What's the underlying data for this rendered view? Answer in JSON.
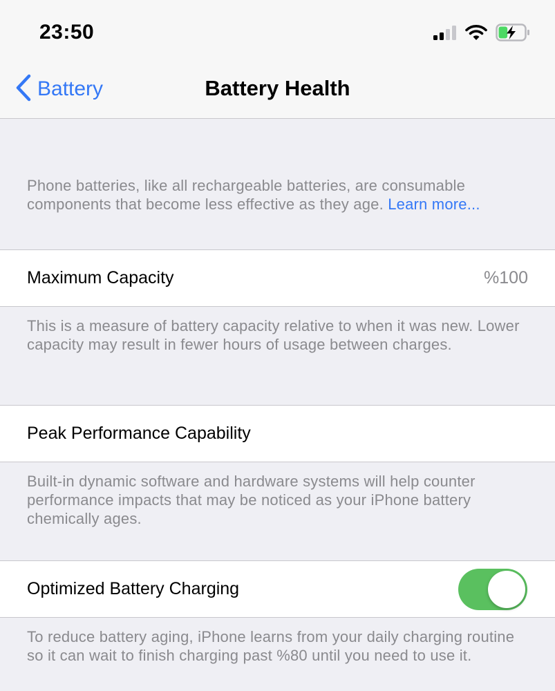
{
  "status_bar": {
    "time": "23:50",
    "signal_icon": "cellular-signal-icon",
    "wifi_icon": "wifi-icon",
    "battery_icon": "battery-charging-icon",
    "battery_fill_fraction": 0.35
  },
  "nav": {
    "back_icon": "chevron-left-icon",
    "back_label": "Battery",
    "title": "Battery Health"
  },
  "intro": {
    "text": "Phone batteries, like all rechargeable batteries, are consumable components that become less effective as they age. ",
    "link_label": "Learn more..."
  },
  "rows": {
    "maximum_capacity": {
      "label": "Maximum Capacity",
      "value": "%100",
      "footer": "This is a measure of battery capacity relative to when it was new. Lower capacity may result in fewer hours of usage between charges."
    },
    "peak_performance": {
      "label": "Peak Performance Capability",
      "footer": "Built-in dynamic software and hardware systems will help counter performance impacts that may be noticed as your iPhone battery chemically ages."
    },
    "optimized_charging": {
      "label": "Optimized Battery Charging",
      "enabled": true,
      "footer": "To reduce battery aging, iPhone learns from your daily charging routine so it can wait to finish charging past %80 until you need to use it."
    }
  },
  "colors": {
    "accent": "#3478f6",
    "toggle_on": "#5ac05f",
    "battery_green": "#4cd964",
    "secondary_text": "#8a8a8e",
    "group_background": "#efeff4"
  }
}
